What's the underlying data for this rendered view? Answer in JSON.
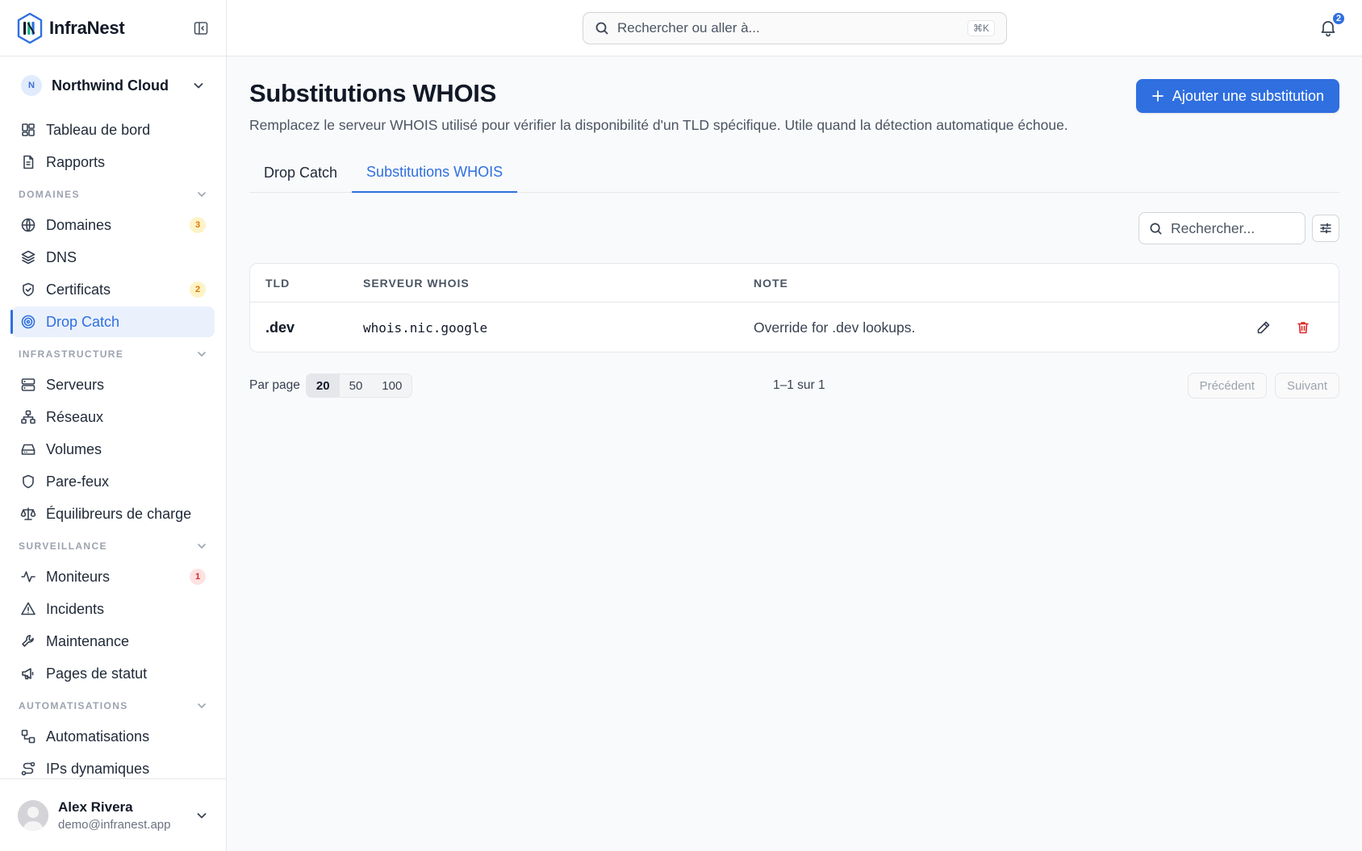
{
  "brand": {
    "name": "InfraNest"
  },
  "org": {
    "initial": "N",
    "name": "Northwind Cloud"
  },
  "nav": {
    "top": [
      {
        "label": "Tableau de bord",
        "icon": "dashboard-icon"
      },
      {
        "label": "Rapports",
        "icon": "file-text-icon"
      }
    ],
    "sections": {
      "domaines": {
        "title": "DOMAINES",
        "items": [
          {
            "label": "Domaines",
            "icon": "globe-icon",
            "badge": "3"
          },
          {
            "label": "DNS",
            "icon": "layers-icon"
          },
          {
            "label": "Certificats",
            "icon": "shield-check-icon",
            "badge": "2"
          },
          {
            "label": "Drop Catch",
            "icon": "target-icon",
            "active": true
          }
        ]
      },
      "infrastructure": {
        "title": "INFRASTRUCTURE",
        "items": [
          {
            "label": "Serveurs",
            "icon": "server-icon"
          },
          {
            "label": "Réseaux",
            "icon": "network-icon"
          },
          {
            "label": "Volumes",
            "icon": "hard-drive-icon"
          },
          {
            "label": "Pare-feux",
            "icon": "shield-icon"
          },
          {
            "label": "Équilibreurs de charge",
            "icon": "scale-icon"
          }
        ]
      },
      "surveillance": {
        "title": "SURVEILLANCE",
        "items": [
          {
            "label": "Moniteurs",
            "icon": "activity-icon",
            "badge": "1"
          },
          {
            "label": "Incidents",
            "icon": "alert-triangle-icon"
          },
          {
            "label": "Maintenance",
            "icon": "wrench-icon"
          },
          {
            "label": "Pages de statut",
            "icon": "megaphone-icon"
          }
        ]
      },
      "automatisations": {
        "title": "AUTOMATISATIONS",
        "items": [
          {
            "label": "Automatisations",
            "icon": "workflow-icon"
          },
          {
            "label": "IPs dynamiques",
            "icon": "route-icon"
          }
        ]
      }
    }
  },
  "user": {
    "name": "Alex Rivera",
    "email": "demo@infranest.app"
  },
  "topbar": {
    "search_placeholder": "Rechercher ou aller à...",
    "shortcut": "⌘K",
    "notifications": "2"
  },
  "page": {
    "title": "Substitutions WHOIS",
    "description": "Remplacez le serveur WHOIS utilisé pour vérifier la disponibilité d'un TLD spécifique. Utile quand la détection automatique échoue.",
    "add_button": "Ajouter une substitution",
    "tabs": [
      {
        "label": "Drop Catch"
      },
      {
        "label": "Substitutions WHOIS",
        "active": true
      }
    ],
    "table_search_placeholder": "Rechercher..."
  },
  "table": {
    "columns": [
      "TLD",
      "SERVEUR WHOIS",
      "NOTE"
    ],
    "rows": [
      {
        "tld": ".dev",
        "server": "whois.nic.google",
        "note": "Override for .dev lookups."
      }
    ]
  },
  "pagination": {
    "per_page_label": "Par page",
    "options": [
      "20",
      "50",
      "100"
    ],
    "selected": "20",
    "range": "1–1 sur 1",
    "prev": "Précédent",
    "next": "Suivant"
  },
  "colors": {
    "accent": "#2f6fe0",
    "danger": "#dc2626",
    "warning": "#d97706"
  }
}
